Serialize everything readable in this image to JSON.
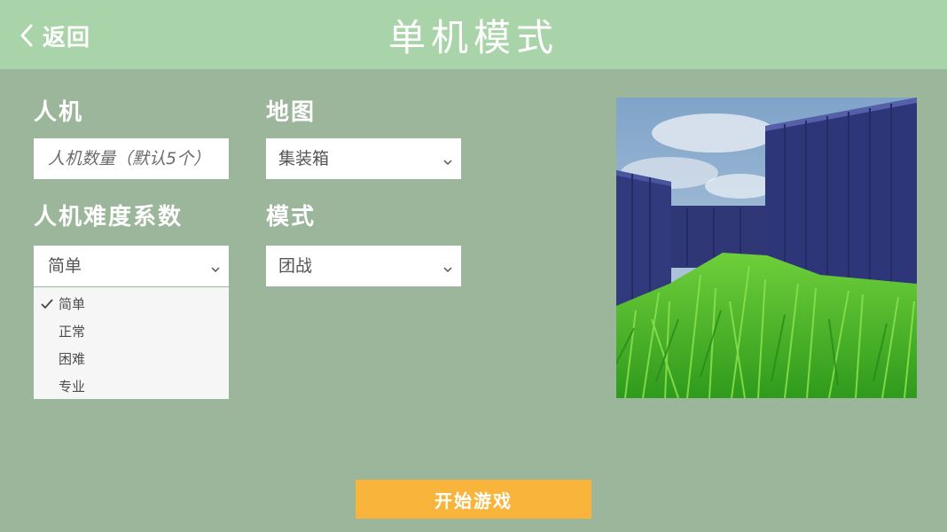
{
  "header": {
    "back_label": "返回",
    "title": "单机模式"
  },
  "form": {
    "bots_label": "人机",
    "bots_placeholder": "人机数量（默认5个）",
    "difficulty_label": "人机难度系数",
    "difficulty_value": "简单",
    "difficulty_options": [
      "简单",
      "正常",
      "困难",
      "专业"
    ],
    "difficulty_selected_index": 0,
    "map_label": "地图",
    "map_value": "集装箱",
    "mode_label": "模式",
    "mode_value": "团战"
  },
  "preview": {
    "icon": "map-preview-image"
  },
  "start_button": {
    "label": "开始游戏"
  },
  "colors": {
    "header_bg": "#a9d4a9",
    "page_bg": "#9bb69a",
    "start_button_bg": "#f9b43b"
  }
}
